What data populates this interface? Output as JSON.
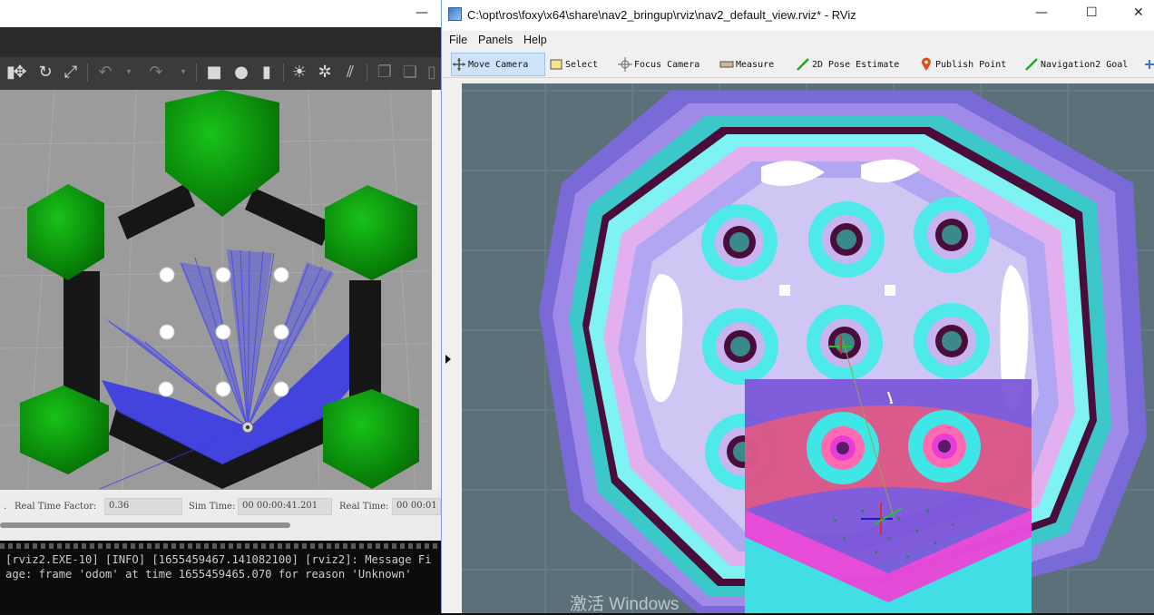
{
  "gazebo": {
    "status": {
      "real_time_factor_label": "Real Time Factor:",
      "real_time_factor": "0.36",
      "sim_time_label": "Sim Time:",
      "sim_time": "00 00:00:41.201",
      "real_time_label": "Real Time:",
      "real_time": "00 00:01"
    }
  },
  "terminal": {
    "lines": [
      "[rviz2.EXE-10] [INFO] [1655459467.141082100] [rviz2]: Message Fi",
      "age: frame 'odom' at time 1655459465.070 for reason 'Unknown'"
    ]
  },
  "rviz": {
    "title": "C:\\opt\\ros\\foxy\\x64\\share\\nav2_bringup\\rviz\\nav2_default_view.rviz* - RViz",
    "menu": [
      "File",
      "Panels",
      "Help"
    ],
    "tools": [
      "Move Camera",
      "Select",
      "Focus Camera",
      "Measure",
      "2D Pose Estimate",
      "Publish Point",
      "Navigation2 Goal"
    ],
    "active_tool": "Move Camera"
  },
  "watermark": "激活 Windows",
  "colors": {
    "robot_green": "#0b8a0b",
    "laser_blue": "#2d2df5",
    "costmap_cyan": "#3fe6e6",
    "map_outline": "#4a0b38"
  }
}
